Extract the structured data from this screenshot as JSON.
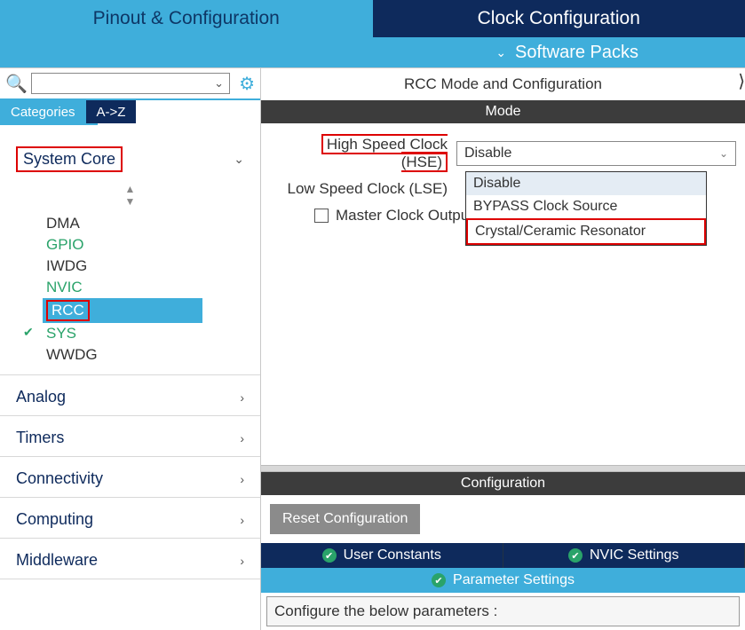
{
  "top_tabs": {
    "pinout": "Pinout & Configuration",
    "clock": "Clock Configuration"
  },
  "software_packs": "Software Packs",
  "left": {
    "search_placeholder": "",
    "cat_tab": "Categories",
    "az_tab": "A->Z",
    "groups": {
      "system_core": "System Core",
      "analog": "Analog",
      "timers": "Timers",
      "connectivity": "Connectivity",
      "computing": "Computing",
      "middleware": "Middleware"
    },
    "tree": {
      "dma": "DMA",
      "gpio": "GPIO",
      "iwdg": "IWDG",
      "nvic": "NVIC",
      "rcc": "RCC",
      "sys": "SYS",
      "wwdg": "WWDG"
    }
  },
  "right": {
    "title": "RCC Mode and Configuration",
    "mode_label": "Mode",
    "hse_label": "High Speed Clock (HSE)",
    "hse_value": "Disable",
    "lse_label": "Low Speed Clock (LSE)",
    "mco_label": "Master Clock Output",
    "dropdown": {
      "opt1": "Disable",
      "opt2": "BYPASS Clock Source",
      "opt3": "Crystal/Ceramic Resonator"
    },
    "configuration_label": "Configuration",
    "reset_btn": "Reset Configuration",
    "tabs": {
      "user_constants": "User Constants",
      "nvic_settings": "NVIC Settings",
      "parameter_settings": "Parameter Settings"
    },
    "param_hint": "Configure the below parameters :"
  }
}
